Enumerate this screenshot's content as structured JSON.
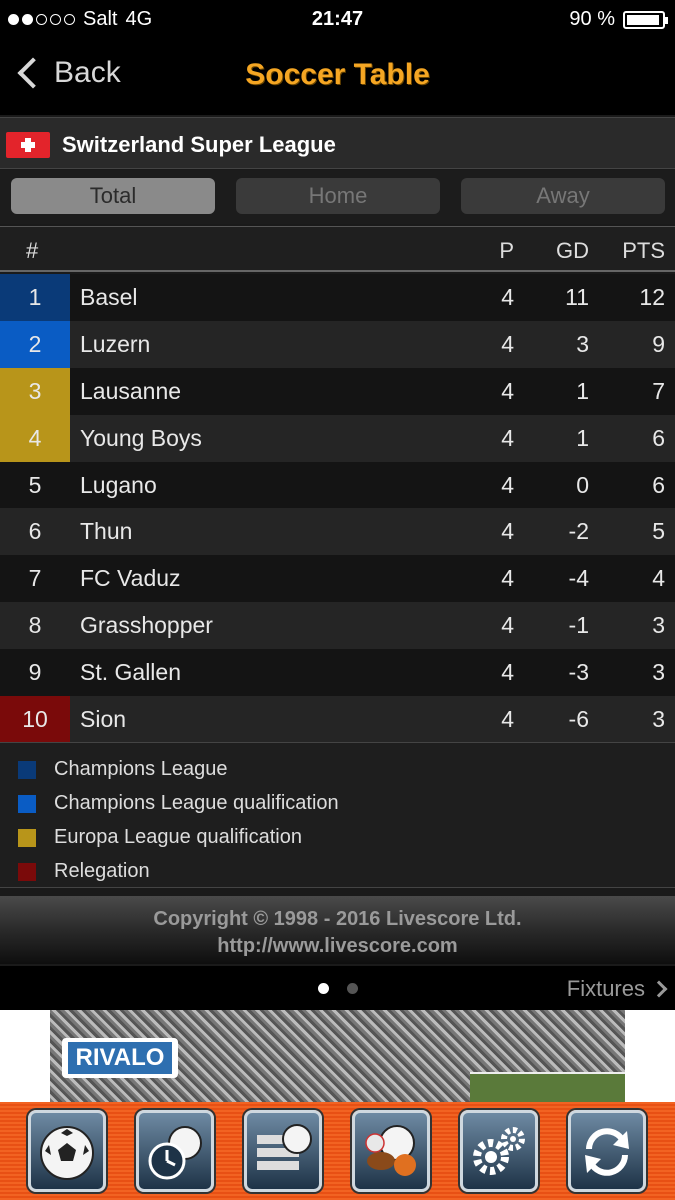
{
  "status_bar": {
    "carrier": "Salt",
    "network": "4G",
    "time": "21:47",
    "battery": "90 %",
    "signal_bars_filled": 2,
    "signal_bars_total": 5
  },
  "nav": {
    "back_label": "Back",
    "title": "Soccer Table"
  },
  "league": {
    "name": "Switzerland Super League",
    "flag": "switzerland-flag"
  },
  "tabs": [
    {
      "label": "Total",
      "active": true
    },
    {
      "label": "Home",
      "active": false
    },
    {
      "label": "Away",
      "active": false
    }
  ],
  "table": {
    "headers": {
      "pos": "#",
      "p": "P",
      "gd": "GD",
      "pts": "PTS"
    },
    "rows": [
      {
        "pos": "1",
        "team": "Basel",
        "p": "4",
        "gd": "11",
        "pts": "12",
        "zone": "cl"
      },
      {
        "pos": "2",
        "team": "Luzern",
        "p": "4",
        "gd": "3",
        "pts": "9",
        "zone": "clq"
      },
      {
        "pos": "3",
        "team": "Lausanne",
        "p": "4",
        "gd": "1",
        "pts": "7",
        "zone": "elq"
      },
      {
        "pos": "4",
        "team": "Young Boys",
        "p": "4",
        "gd": "1",
        "pts": "6",
        "zone": "elq"
      },
      {
        "pos": "5",
        "team": "Lugano",
        "p": "4",
        "gd": "0",
        "pts": "6",
        "zone": ""
      },
      {
        "pos": "6",
        "team": "Thun",
        "p": "4",
        "gd": "-2",
        "pts": "5",
        "zone": ""
      },
      {
        "pos": "7",
        "team": "FC Vaduz",
        "p": "4",
        "gd": "-4",
        "pts": "4",
        "zone": ""
      },
      {
        "pos": "8",
        "team": "Grasshopper",
        "p": "4",
        "gd": "-1",
        "pts": "3",
        "zone": ""
      },
      {
        "pos": "9",
        "team": "St. Gallen",
        "p": "4",
        "gd": "-3",
        "pts": "3",
        "zone": ""
      },
      {
        "pos": "10",
        "team": "Sion",
        "p": "4",
        "gd": "-6",
        "pts": "3",
        "zone": "rel"
      }
    ]
  },
  "legend": [
    {
      "key": "cl",
      "label": "Champions League",
      "color": "#0a3a78"
    },
    {
      "key": "clq",
      "label": "Champions League qualification",
      "color": "#0a5cc4"
    },
    {
      "key": "elq",
      "label": "Europa League qualification",
      "color": "#b8951a"
    },
    {
      "key": "rel",
      "label": "Relegation",
      "color": "#7a0a0a"
    }
  ],
  "copyright": {
    "line1": "Copyright © 1998 - 2016 Livescore Ltd.",
    "line2": "http://www.livescore.com"
  },
  "pager": {
    "pages": 2,
    "current": 1,
    "next_label": "Fixtures"
  },
  "ad": {
    "brand": "RIVALO"
  },
  "toolbar": [
    {
      "icon": "soccer-ball-icon"
    },
    {
      "icon": "clock-ball-icon"
    },
    {
      "icon": "list-ball-icon"
    },
    {
      "icon": "multi-sports-icon"
    },
    {
      "icon": "settings-gears-icon"
    },
    {
      "icon": "refresh-icon"
    }
  ]
}
